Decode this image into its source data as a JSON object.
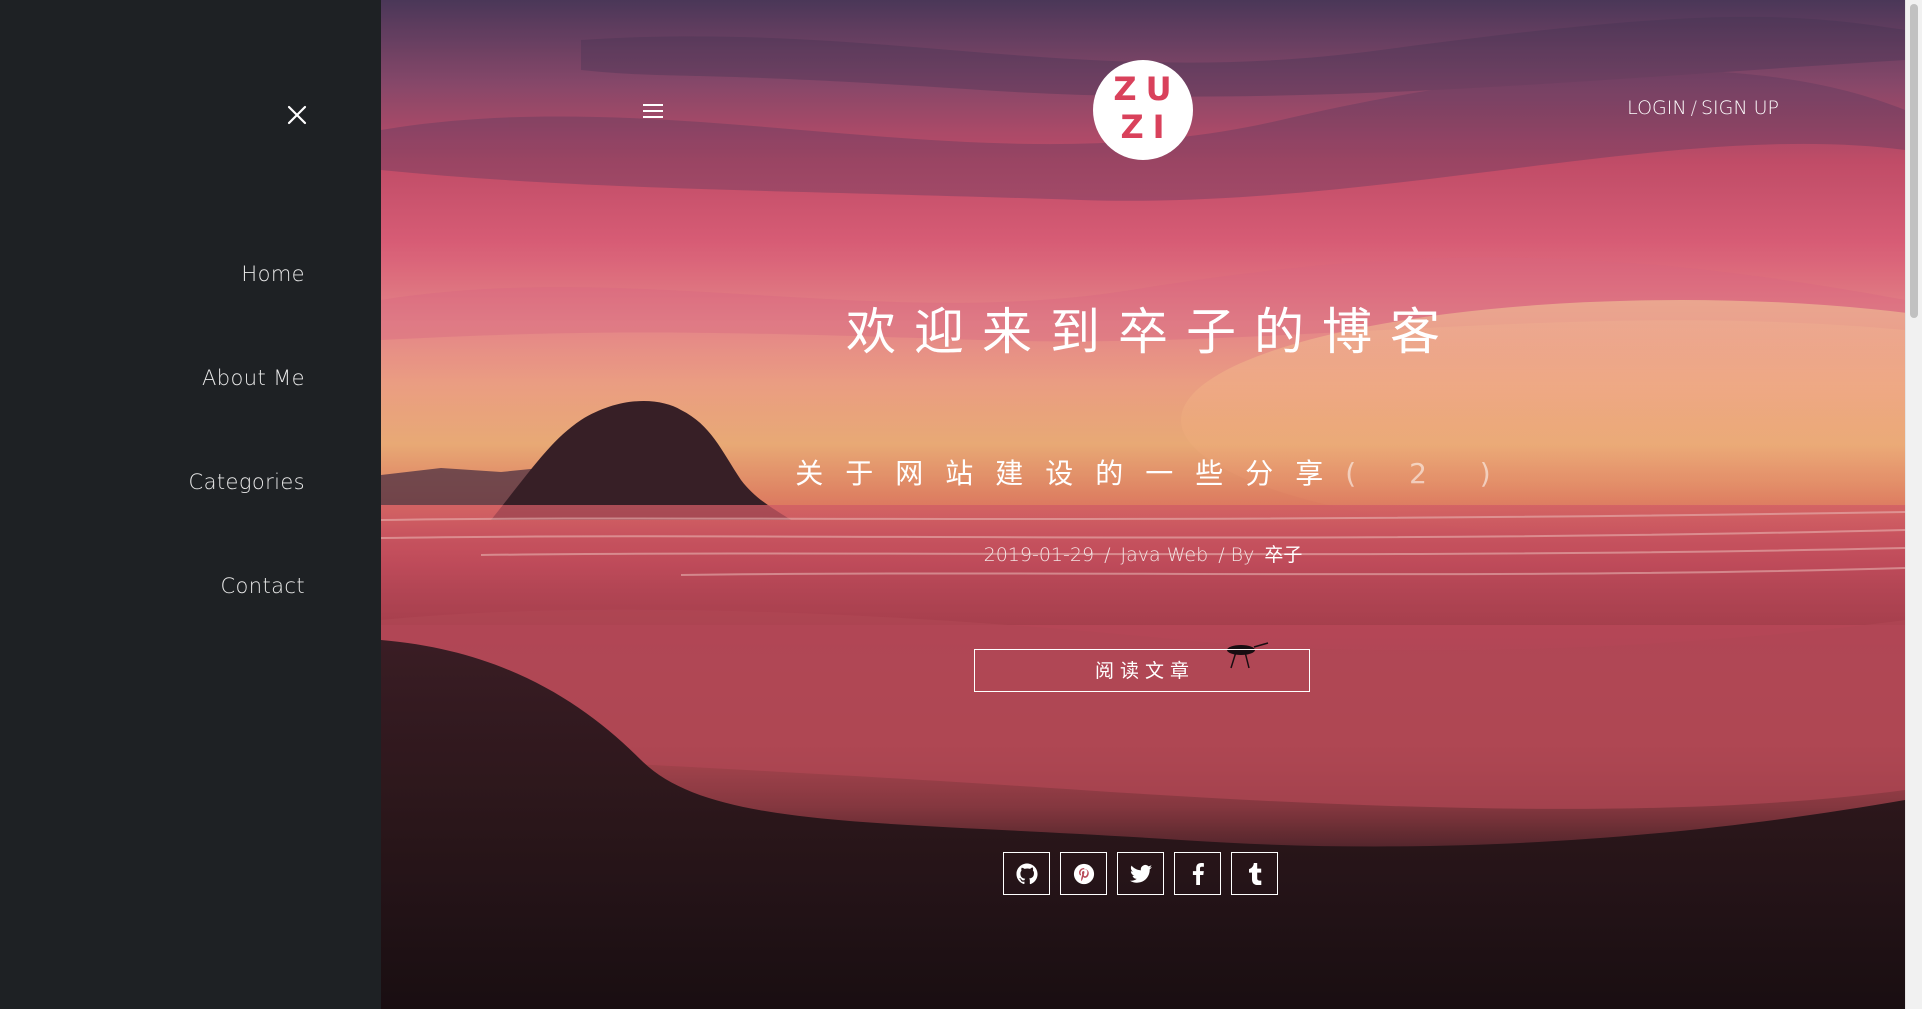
{
  "sidebar": {
    "close_icon": "close-icon",
    "items": [
      {
        "label": "Home"
      },
      {
        "label": "About Me"
      },
      {
        "label": "Categories"
      },
      {
        "label": "Contact"
      }
    ]
  },
  "header": {
    "menu_icon": "hamburger-menu-icon",
    "logo": {
      "line1": "ZU",
      "line2": "ZI"
    },
    "login_label": "LOGIN",
    "auth_separator": "/",
    "signup_label": "SIGN UP"
  },
  "hero": {
    "site_title": "欢迎来到卒子的博客",
    "post_title": "关于网站建设的一些分享",
    "post_number": "( 2 )",
    "post_date": "2019-01-29",
    "meta_sep_1": "/",
    "post_category": "Java Web",
    "meta_sep_2": "/ By",
    "post_author": "卒子",
    "read_button": "阅读文章"
  },
  "social": [
    {
      "name": "github",
      "icon": "github-icon"
    },
    {
      "name": "pinterest",
      "icon": "pinterest-icon"
    },
    {
      "name": "twitter",
      "icon": "twitter-icon"
    },
    {
      "name": "facebook",
      "icon": "facebook-icon"
    },
    {
      "name": "tumblr",
      "icon": "tumblr-icon"
    }
  ],
  "colors": {
    "sidebar_bg": "#1e2124",
    "logo_text": "#d9415b",
    "logo_bg": "#ffffff"
  }
}
